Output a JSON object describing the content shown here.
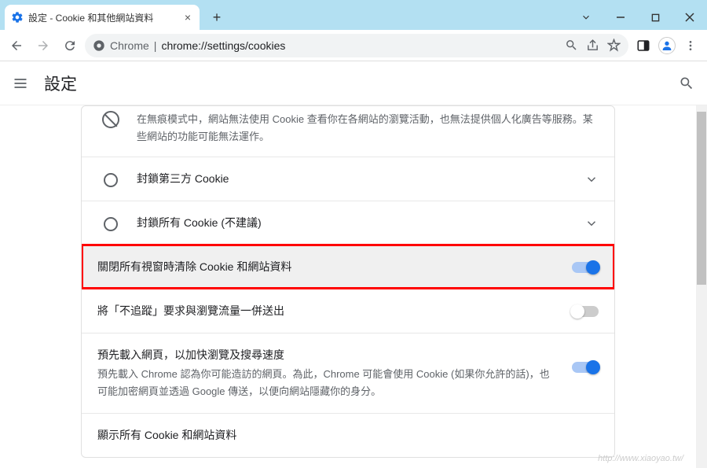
{
  "window": {
    "tab_title": "設定 - Cookie 和其他網站資料",
    "chrome_label": "Chrome",
    "url_path": "chrome://settings/cookies"
  },
  "header": {
    "title": "設定"
  },
  "incognito_row": {
    "desc": "在無痕模式中，網站無法使用 Cookie 查看你在各網站的瀏覽活動，也無法提供個人化廣告等服務。某些網站的功能可能無法運作。"
  },
  "radio_block_third": {
    "label": "封鎖第三方 Cookie"
  },
  "radio_block_all": {
    "label": "封鎖所有 Cookie (不建議)"
  },
  "clear_on_exit": {
    "label": "關閉所有視窗時清除 Cookie 和網站資料"
  },
  "dnt": {
    "label": "將「不追蹤」要求與瀏覽流量一併送出"
  },
  "preload": {
    "label": "預先載入網頁，以加快瀏覽及搜尋速度",
    "desc": "預先載入 Chrome 認為你可能造訪的網頁。為此，Chrome 可能會使用 Cookie (如果你允許的話)，也可能加密網頁並透過 Google 傳送，以便向網站隱藏你的身分。"
  },
  "see_all": {
    "label": "顯示所有 Cookie 和網站資料"
  },
  "watermark": "http://www.xiaoyao.tw/"
}
